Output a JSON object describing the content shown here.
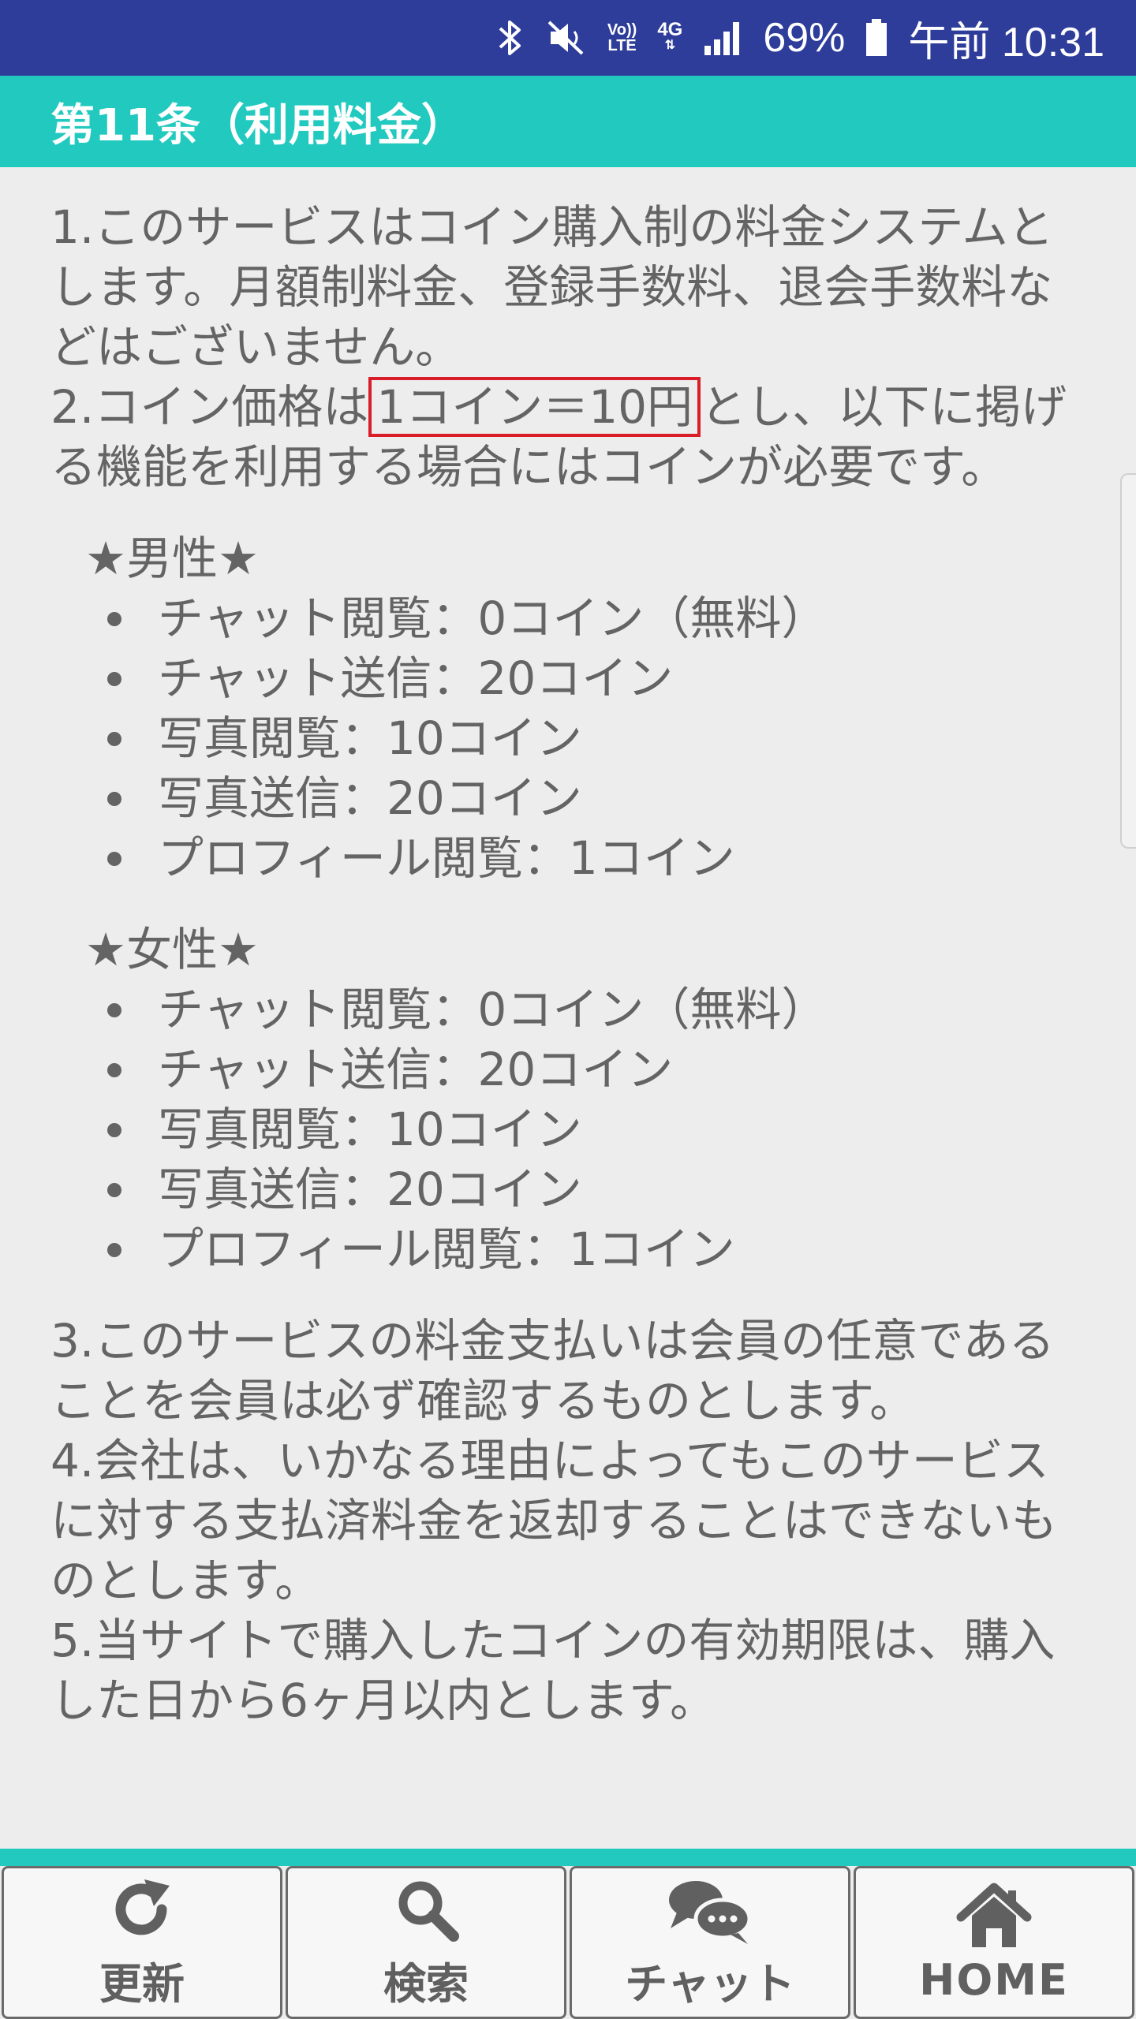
{
  "status_bar": {
    "bluetooth_icon": "bluetooth-icon",
    "mute_icon": "vibrate-mute-icon",
    "volte_top": "Vo))",
    "volte_bottom": "LTE",
    "network_label": "4G",
    "battery_percent": "69%",
    "time": "午前 10:31",
    "background_color": "#2e3d9a"
  },
  "section": {
    "title": "第11条（利用料金）",
    "accent_color": "#22c9bf"
  },
  "paragraphs": {
    "p1": "1.このサービスはコイン購入制の料金システムとします。月額制料金、登録手数料、退会手数料などはございません。",
    "p2_before": "2.コイン価格は",
    "p2_highlight": "1コイン＝10円",
    "p2_after": "とし、以下に掲げる機能を利用する場合にはコインが必要です。",
    "p3": "3.このサービスの料金支払いは会員の任意であることを会員は必ず確認するものとします。",
    "p4": "4.会社は、いかなる理由によってもこのサービスに対する支払済料金を返却することはできないものとします。",
    "p5": "5.当サイトで購入したコインの有効期限は、購入した日から6ヶ月以内とします。"
  },
  "male": {
    "title": "★男性★",
    "items": [
      "チャット閲覧：0コイン（無料）",
      "チャット送信：20コイン",
      "写真閲覧：10コイン",
      "写真送信：20コイン",
      "プロフィール閲覧：1コイン"
    ]
  },
  "female": {
    "title": "★女性★",
    "items": [
      "チャット閲覧：0コイン（無料）",
      "チャット送信：20コイン",
      "写真閲覧：10コイン",
      "写真送信：20コイン",
      "プロフィール閲覧：1コイン"
    ]
  },
  "nav": {
    "refresh": {
      "label": "更新",
      "icon": "refresh-icon"
    },
    "search": {
      "label": "検索",
      "icon": "search-icon"
    },
    "chat": {
      "label": "チャット",
      "icon": "chat-icon"
    },
    "home": {
      "label": "HOME",
      "icon": "home-icon"
    }
  }
}
